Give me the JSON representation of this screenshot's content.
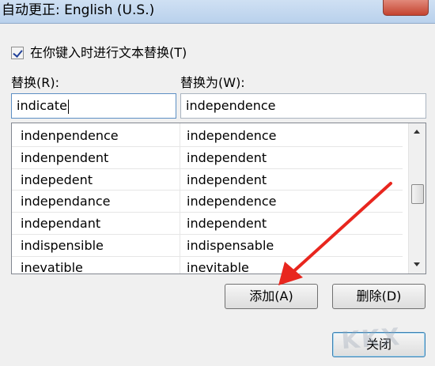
{
  "window": {
    "title": "自动更正: English (U.S.)"
  },
  "options": {
    "replace_as_you_type_label": "在你键入时进行文本替换(T)",
    "replace_as_you_type_checked": true
  },
  "fields": {
    "replace_label": "替换(R):",
    "with_label": "替换为(W):",
    "replace_value": "indicate",
    "with_value": "independence"
  },
  "list": {
    "rows": [
      {
        "replace": "indenpendence",
        "with": "independence"
      },
      {
        "replace": "indenpendent",
        "with": "independent"
      },
      {
        "replace": "indepedent",
        "with": "independent"
      },
      {
        "replace": "independance",
        "with": "independence"
      },
      {
        "replace": "independant",
        "with": "independent"
      },
      {
        "replace": "indispensible",
        "with": "indispensable"
      },
      {
        "replace": "inevatible",
        "with": "inevitable"
      }
    ]
  },
  "buttons": {
    "add": "添加(A)",
    "delete": "删除(D)",
    "close": "关闭"
  },
  "watermark": {
    "text": "KKX"
  },
  "colors": {
    "annotation_arrow": "#e8261e",
    "title_bar": "#c4d8ef"
  }
}
